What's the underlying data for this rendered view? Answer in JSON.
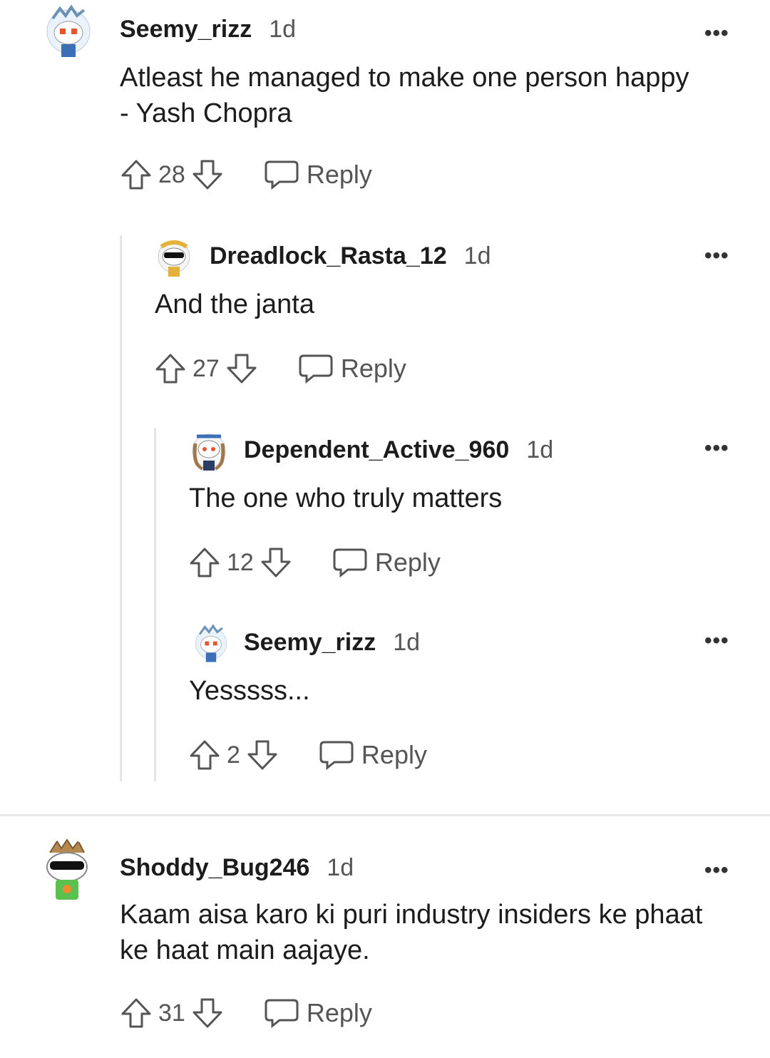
{
  "comments": [
    {
      "username": "Seemy_rizz",
      "time": "1d",
      "body": "Atleast he managed to make one person happy - Yash Chopra",
      "votes": "28",
      "reply_label": "Reply",
      "avatar_icon": "snoo-avatar-icon"
    },
    {
      "username": "Dreadlock_Rasta_12",
      "time": "1d",
      "body": "And the janta",
      "votes": "27",
      "reply_label": "Reply",
      "avatar_icon": "snoo-avatar-icon"
    },
    {
      "username": "Dependent_Active_960",
      "time": "1d",
      "body": "The one who truly matters",
      "votes": "12",
      "reply_label": "Reply",
      "avatar_icon": "snoo-avatar-icon"
    },
    {
      "username": "Seemy_rizz",
      "time": "1d",
      "body": "Yesssss...",
      "votes": "2",
      "reply_label": "Reply",
      "avatar_icon": "snoo-avatar-icon"
    },
    {
      "username": "Shoddy_Bug246",
      "time": "1d",
      "body": "Kaam aisa karo ki puri industry insiders ke phaat ke haat main aajaye.",
      "votes": "31",
      "reply_label": "Reply",
      "avatar_icon": "snoo-avatar-icon"
    }
  ],
  "more_icon": "•••",
  "colors": {
    "text": "#1c1c1c",
    "meta": "#555555",
    "thread_line": "#e5e5e5"
  }
}
